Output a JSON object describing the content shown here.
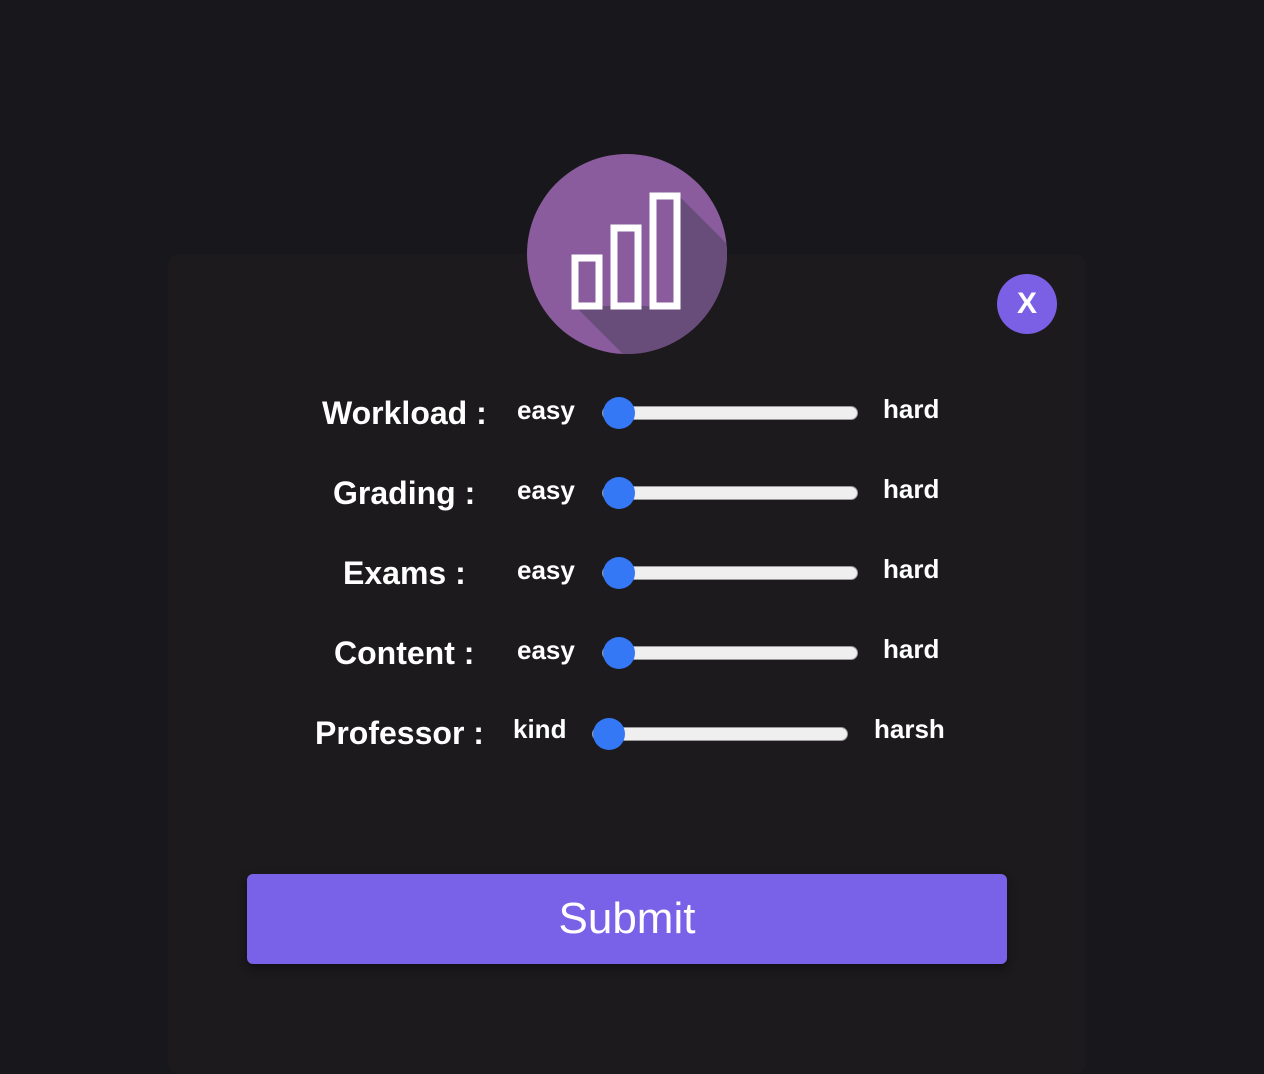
{
  "colors": {
    "background": "#18171c",
    "card": "#1c1a1d",
    "accent": "#7a62e8",
    "logo_circle": "#8a5c9e",
    "slider_thumb": "#3478f6"
  },
  "logo": {
    "icon": "bar-chart-icon"
  },
  "close_button": {
    "label": "X"
  },
  "ratings": [
    {
      "label": "Workload :",
      "min_label": "easy",
      "max_label": "hard",
      "value": 0
    },
    {
      "label": "Grading :",
      "min_label": "easy",
      "max_label": "hard",
      "value": 0
    },
    {
      "label": "Exams :",
      "min_label": "easy",
      "max_label": "hard",
      "value": 0
    },
    {
      "label": "Content :",
      "min_label": "easy",
      "max_label": "hard",
      "value": 0
    },
    {
      "label": "Professor :",
      "min_label": "kind",
      "max_label": "harsh",
      "value": 0
    }
  ],
  "submit": {
    "label": "Submit"
  }
}
